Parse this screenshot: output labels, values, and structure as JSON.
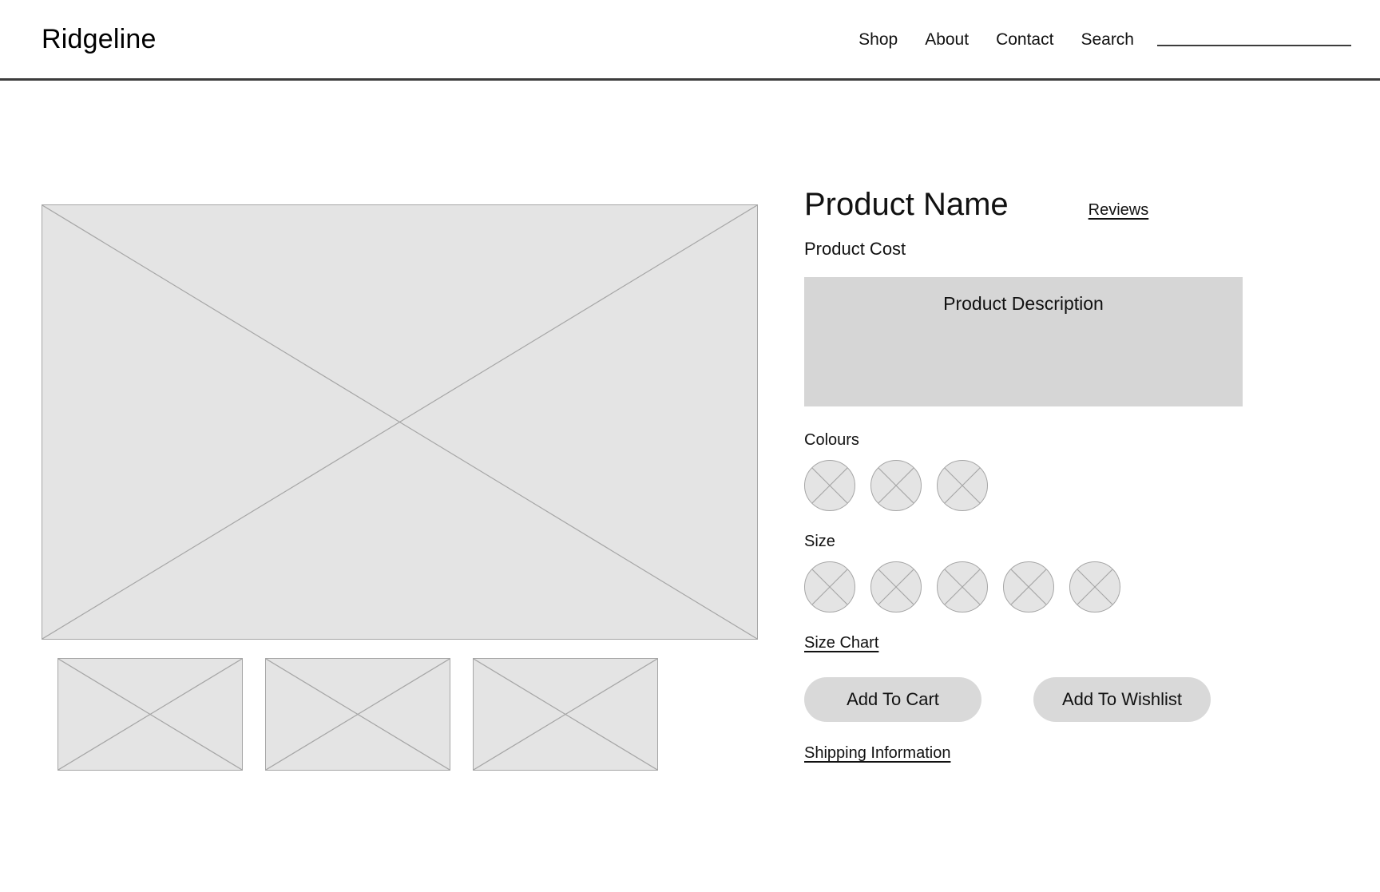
{
  "header": {
    "brand": "Ridgeline",
    "nav": [
      {
        "label": "Shop",
        "name": "nav-link-shop"
      },
      {
        "label": "About",
        "name": "nav-link-about"
      },
      {
        "label": "Contact",
        "name": "nav-link-contact"
      },
      {
        "label": "Search",
        "name": "nav-link-search"
      }
    ],
    "search": {
      "value": "",
      "placeholder": ""
    }
  },
  "gallery": {
    "hero": {
      "alt": "image-placeholder"
    },
    "thumbnails": [
      {
        "alt": "image-placeholder"
      },
      {
        "alt": "image-placeholder"
      },
      {
        "alt": "image-placeholder"
      }
    ]
  },
  "product": {
    "title": "Product Name",
    "reviews_link": "Reviews",
    "cost": "Product Cost",
    "description": "Product Description",
    "colours_label": "Colours",
    "colour_swatches": [
      {
        "alt": "colour-swatch"
      },
      {
        "alt": "colour-swatch"
      },
      {
        "alt": "colour-swatch"
      }
    ],
    "size_label": "Size",
    "size_swatches": [
      {
        "alt": "size-option"
      },
      {
        "alt": "size-option"
      },
      {
        "alt": "size-option"
      },
      {
        "alt": "size-option"
      },
      {
        "alt": "size-option"
      }
    ],
    "size_chart_link": "Size Chart",
    "add_to_cart_label": "Add To Cart",
    "add_to_wishlist_label": "Add To Wishlist",
    "shipping_link": "Shipping Information"
  },
  "colors": {
    "placeholder_fill": "#e4e4e4",
    "placeholder_stroke": "#a6a6a6",
    "description_fill": "#d6d6d6",
    "button_fill": "#d9d9d9",
    "rule": "#3c3c3c",
    "text": "#111111"
  }
}
